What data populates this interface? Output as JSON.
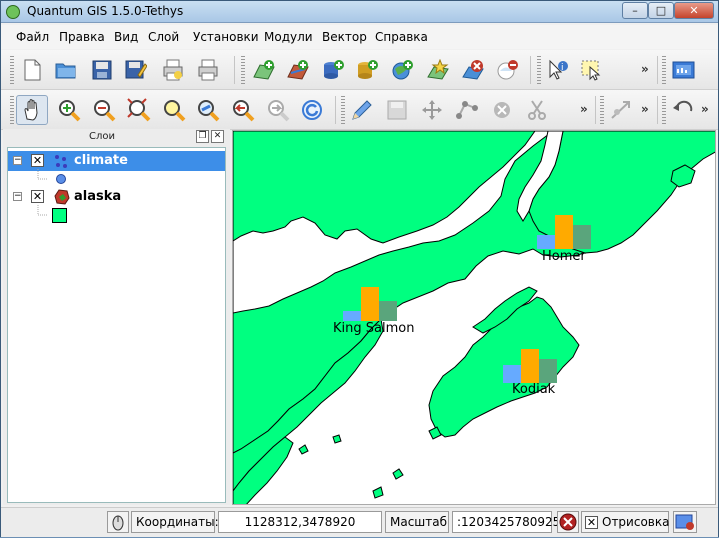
{
  "window": {
    "title": "Quantum GIS 1.5.0-Tethys"
  },
  "menu": [
    "Файл",
    "Правка",
    "Вид",
    "Слой",
    "Установки",
    "Модули",
    "Вектор",
    "Справка"
  ],
  "toolbar1": {
    "icons": [
      "new-project-icon",
      "open-project-icon",
      "save-project-icon",
      "save-as-icon",
      "print-composer-icon",
      "print-icon",
      "add-vector-layer-icon",
      "add-raster-layer-icon",
      "add-postgis-layer-icon",
      "add-spatialite-layer-icon",
      "add-wms-layer-icon",
      "new-vector-layer-icon",
      "remove-layer-icon",
      "overview-icon",
      "identify-icon",
      "select-features-icon",
      "plugin-icon"
    ]
  },
  "toolbar2": {
    "icons": [
      "pan-icon",
      "zoom-in-icon",
      "zoom-out-icon",
      "zoom-full-icon",
      "zoom-selection-icon",
      "zoom-layer-icon",
      "zoom-last-icon",
      "zoom-next-icon",
      "refresh-icon",
      "edit-pencil-icon",
      "save-edits-icon",
      "move-feature-icon",
      "node-tool-icon",
      "delete-selected-icon",
      "cut-features-icon",
      "split-features-icon",
      "undo-icon"
    ]
  },
  "more_glyph": "»",
  "layers_panel": {
    "title": "Слои",
    "layers": [
      {
        "name": "climate",
        "visible": true,
        "selected": true,
        "symbol_color": "#5a8ee8"
      },
      {
        "name": "alaska",
        "visible": true,
        "selected": false,
        "symbol_color": "#00ff80"
      }
    ]
  },
  "map": {
    "land_color": "#00ff80",
    "water_color": "#ffffff",
    "diagram_colors": [
      "#66aaff",
      "#ffaa00",
      "#5aa57c"
    ],
    "labels": [
      {
        "name": "Homer",
        "values": [
          0.4,
          1.0,
          0.7
        ]
      },
      {
        "name": "King Salmon",
        "values": [
          0.3,
          1.0,
          0.6
        ]
      },
      {
        "name": "Kodiak",
        "values": [
          0.5,
          1.0,
          0.7
        ]
      }
    ]
  },
  "status": {
    "coords_label": "Координаты:",
    "coords_value": "1128312,3478920",
    "scale_label": "Масштаб",
    "scale_value": ":1203425780925",
    "render_label": "Отрисовка",
    "render_checked": true
  }
}
